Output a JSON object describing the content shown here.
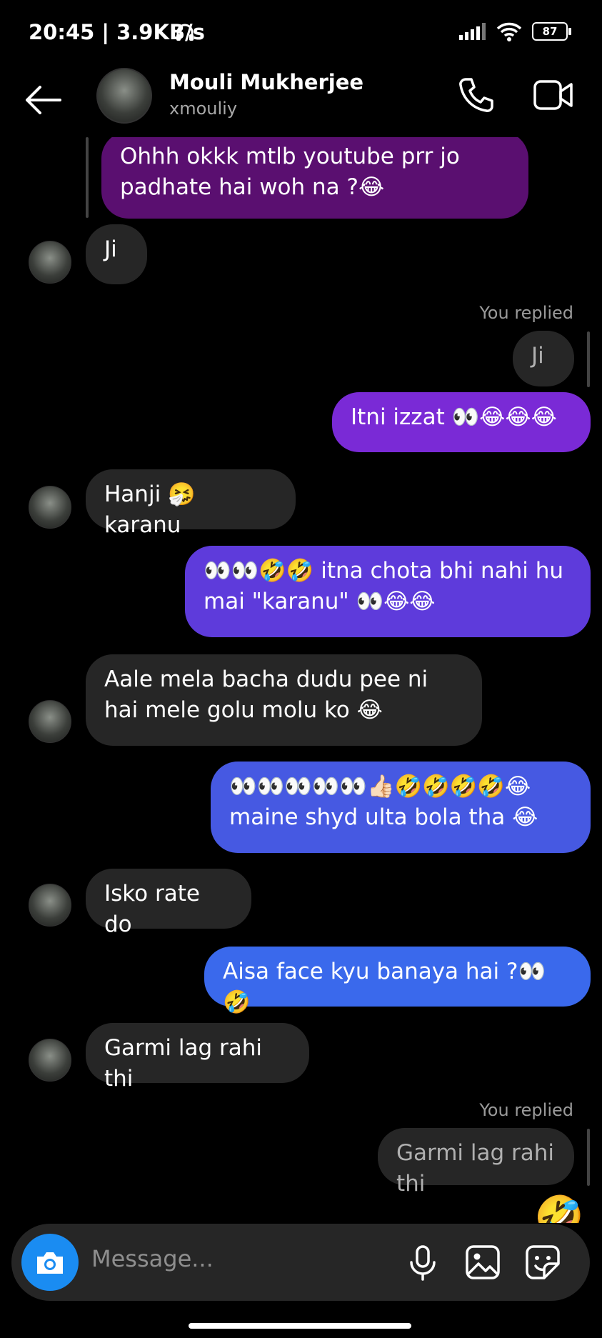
{
  "status_bar": {
    "time_net": "20:45 | 3.9KB/s",
    "battery": "87"
  },
  "header": {
    "name": "Mouli Mukherjee",
    "username": "xmouliy"
  },
  "messages": [
    {
      "text": "Ohhh okkk mtlb youtube prr jo padhate hai woh na ?😂"
    },
    {
      "text": "Ji"
    },
    {
      "text": "Itni izzat 👀😂😂😂"
    },
    {
      "text": "Hanji 🤧 karanu"
    },
    {
      "text": "👀👀🤣🤣 itna chota bhi nahi hu mai \"karanu\" 👀😂😂"
    },
    {
      "text": "Aale mela bacha dudu pee ni hai mele golu molu ko 😂"
    },
    {
      "text": "👀👀👀👀👀👍🏻🤣🤣🤣🤣😂 maine shyd ulta bola tha 😂"
    },
    {
      "text": "Isko rate do"
    },
    {
      "text": "Aisa face kyu banaya hai ?👀🤣"
    },
    {
      "text": "Garmi lag rahi thi"
    }
  ],
  "replies": [
    {
      "label": "You replied",
      "quoted": "Ji"
    },
    {
      "label": "You replied",
      "quoted": "Garmi lag rahi thi"
    }
  ],
  "reaction": "🤣",
  "composer": {
    "placeholder": "Message..."
  },
  "colors": {
    "incoming": "#262626",
    "outgoing_start": "#7a2ad6",
    "outgoing_end": "#3a69ec",
    "camera": "#1a8cf2"
  }
}
